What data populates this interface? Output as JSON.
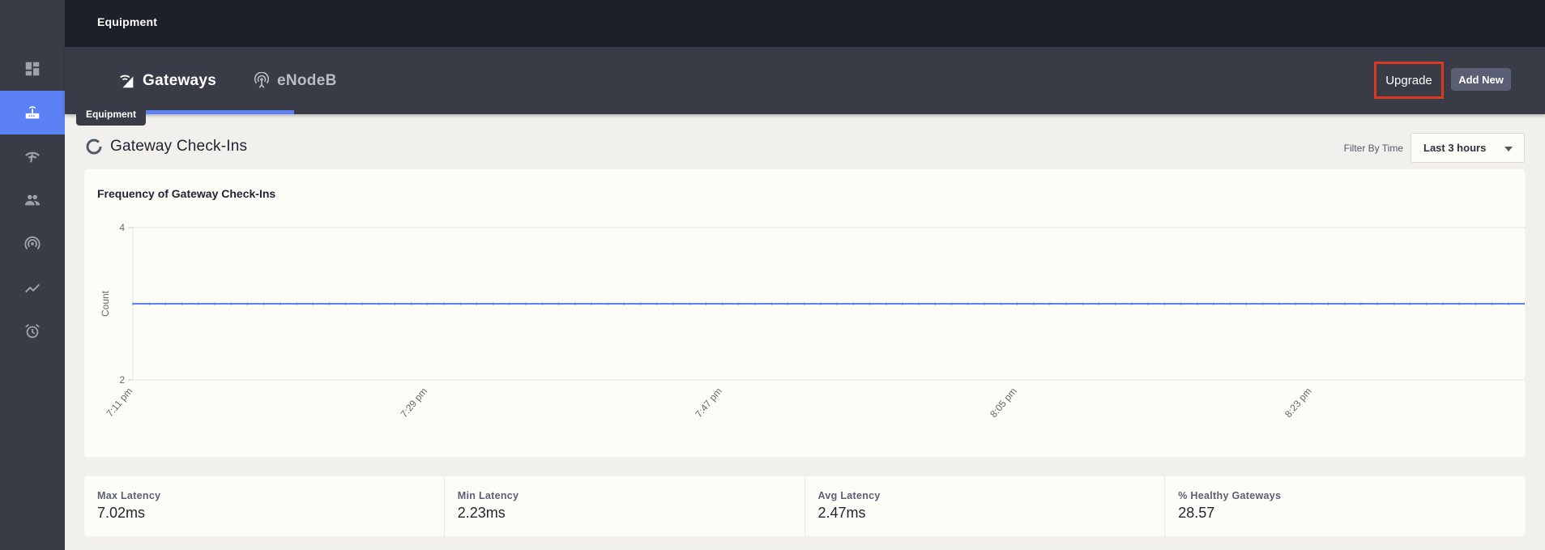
{
  "header": {
    "title": "Equipment"
  },
  "sidebar": {
    "items": [
      {
        "icon": "dashboard-icon",
        "active": false
      },
      {
        "icon": "router-icon",
        "active": true,
        "tooltip": "Equipment"
      },
      {
        "icon": "network-icon",
        "active": false
      },
      {
        "icon": "subscribers-icon",
        "active": false
      },
      {
        "icon": "signal-icon",
        "active": false
      },
      {
        "icon": "metrics-icon",
        "active": false
      },
      {
        "icon": "alarm-icon",
        "active": false
      }
    ]
  },
  "tabs": [
    {
      "label": "Gateways",
      "icon": "gateway-icon",
      "active": true
    },
    {
      "label": "eNodeB",
      "icon": "antenna-icon",
      "active": false
    }
  ],
  "actions": {
    "upgrade": "Upgrade",
    "add_new": "Add New"
  },
  "tooltip": {
    "label": "Equipment"
  },
  "section": {
    "title": "Gateway Check-Ins",
    "filter_label": "Filter By Time",
    "filter_value": "Last 3 hours"
  },
  "chart_data": {
    "type": "line",
    "title": "Frequency of Gateway Check-Ins",
    "xlabel": "",
    "ylabel": "Count",
    "ylim": [
      2,
      4
    ],
    "yticks": [
      "4",
      "2"
    ],
    "xticks": [
      "7:11 pm",
      "7:29 pm",
      "7:47 pm",
      "8:05 pm",
      "8:23 pm"
    ],
    "xrange_minutes": [
      0,
      85
    ],
    "series": [
      {
        "name": "Check-Ins",
        "color": "#5c81f5",
        "x_minutes_start": 0,
        "x_minutes_end": 85,
        "value": 3
      }
    ],
    "grid": false
  },
  "stats": [
    {
      "label": "Max Latency",
      "value": "7.02ms"
    },
    {
      "label": "Min Latency",
      "value": "2.23ms"
    },
    {
      "label": "Avg Latency",
      "value": "2.47ms"
    },
    {
      "label": "% Healthy Gateways",
      "value": "28.57"
    }
  ]
}
